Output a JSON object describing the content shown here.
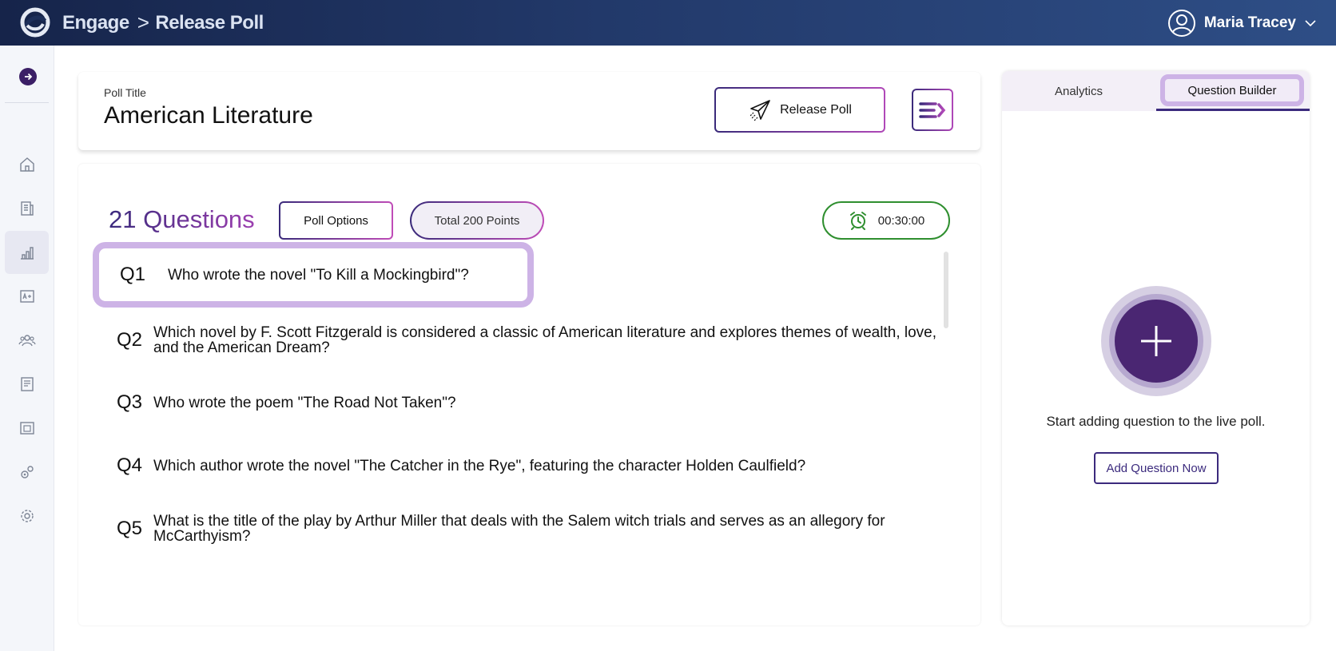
{
  "header": {
    "app_name": "Engage",
    "separator": ">",
    "page_name": "Release Poll",
    "user_name": "Maria Tracey"
  },
  "sidebar": {
    "items": [
      {
        "icon": "home-icon",
        "active": false
      },
      {
        "icon": "document-icon",
        "active": false
      },
      {
        "icon": "bar-chart-icon",
        "active": true
      },
      {
        "icon": "grade-icon",
        "active": false
      },
      {
        "icon": "users-icon",
        "active": false
      },
      {
        "icon": "notes-icon",
        "active": false
      },
      {
        "icon": "classroom-icon",
        "active": false
      },
      {
        "icon": "integrations-icon",
        "active": false
      },
      {
        "icon": "settings-icon",
        "active": false
      }
    ]
  },
  "poll": {
    "title_label": "Poll Title",
    "title": "American Literature",
    "release_label": "Release Poll"
  },
  "questions": {
    "count_label": "21 Questions",
    "poll_options_label": "Poll Options",
    "points_label": "Total 200 Points",
    "timer": "00:30:00",
    "items": [
      {
        "num": "Q1",
        "text": "Who wrote the novel \"To Kill a Mockingbird\"?"
      },
      {
        "num": "Q2",
        "text": "Which novel by F. Scott Fitzgerald is considered a classic of American literature and explores themes of wealth, love, and the American Dream?"
      },
      {
        "num": "Q3",
        "text": "Who wrote the poem \"The Road Not Taken\"?"
      },
      {
        "num": "Q4",
        "text": "Which author wrote the novel \"The Catcher in the Rye\", featuring the character Holden Caulfield?"
      },
      {
        "num": "Q5",
        "text": "What is the title of the play by Arthur Miller that deals with the Salem witch trials and serves as an allegory for McCarthyism?"
      }
    ]
  },
  "right_panel": {
    "tab_analytics": "Analytics",
    "tab_builder": "Question Builder",
    "empty_text": "Start adding question to the live poll.",
    "add_button": "Add Question Now"
  },
  "colors": {
    "accent": "#3b2a7d",
    "highlight": "#cdb3e6",
    "timer_green": "#2f8f2f"
  }
}
